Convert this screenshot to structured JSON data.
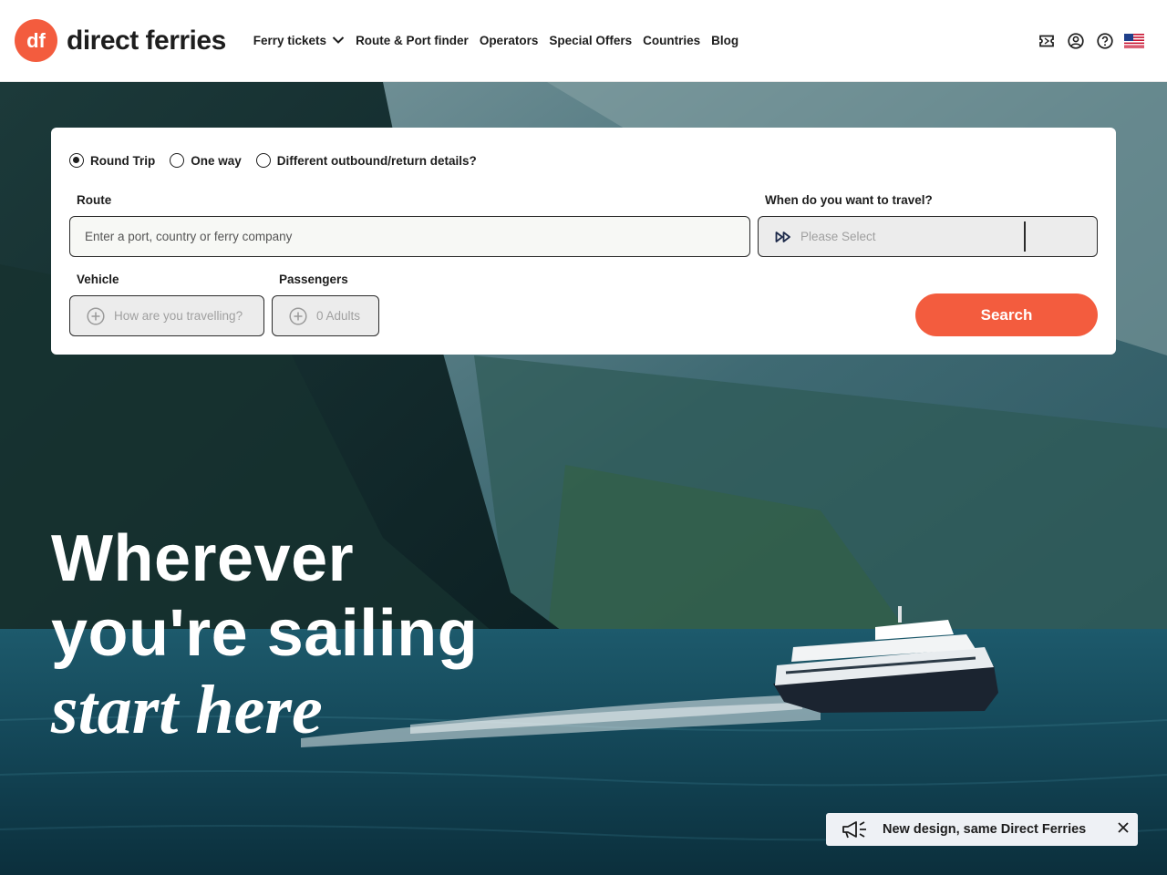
{
  "brand": {
    "logo_mark_text": "df",
    "name": "direct ferries",
    "accent_color": "#f35c3e"
  },
  "nav": {
    "items": [
      {
        "label": "Ferry tickets",
        "has_dropdown": true
      },
      {
        "label": "Route & Port finder"
      },
      {
        "label": "Operators"
      },
      {
        "label": "Special Offers"
      },
      {
        "label": "Countries"
      },
      {
        "label": "Blog"
      }
    ],
    "icons": [
      "ticket-icon",
      "account-icon",
      "help-icon",
      "us-flag-icon"
    ]
  },
  "search": {
    "trip_types": [
      {
        "label": "Round Trip",
        "selected": true
      },
      {
        "label": "One way",
        "selected": false
      },
      {
        "label": "Different outbound/return details?",
        "selected": false
      }
    ],
    "route_label": "Route",
    "route_placeholder": "Enter a port, country or ferry company",
    "date_label": "When do you want to travel?",
    "date_placeholder": "Please Select",
    "vehicle_label": "Vehicle",
    "vehicle_placeholder": "How are you travelling?",
    "passengers_label": "Passengers",
    "passengers_placeholder": "0 Adults",
    "search_button": "Search"
  },
  "hero": {
    "line1": "Wherever",
    "line2": "you're sailing",
    "line3": "start here"
  },
  "toast": {
    "message": "New design, same Direct Ferries"
  }
}
